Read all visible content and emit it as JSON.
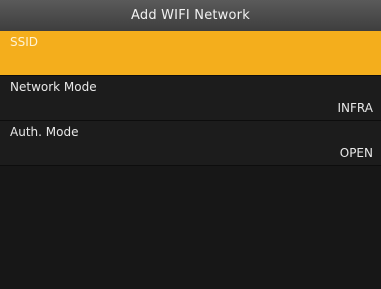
{
  "window": {
    "title": "Add WIFI Network"
  },
  "menu": {
    "items": [
      {
        "label": "SSID",
        "value": "",
        "selected": true
      },
      {
        "label": "Network Mode",
        "value": "INFRA",
        "selected": false
      },
      {
        "label": "Auth. Mode",
        "value": "OPEN",
        "selected": false
      }
    ]
  },
  "colors": {
    "highlight": "#f4ae1c",
    "background": "#1a1a1a",
    "title_bar": "#4a4a4a"
  }
}
